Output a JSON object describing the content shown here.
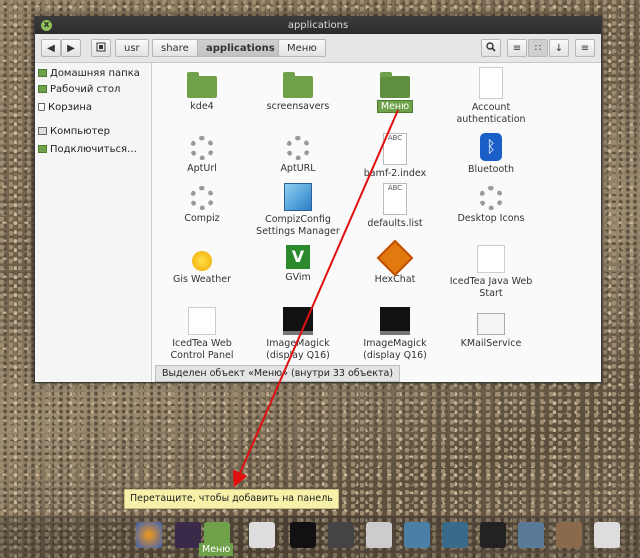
{
  "window": {
    "title": "applications",
    "close_glyph": "x"
  },
  "toolbar": {
    "back_glyph": "◀",
    "forward_glyph": "▶",
    "crumbs": [
      "usr",
      "share",
      "applications",
      "Меню"
    ],
    "search_glyph": "⌕",
    "view_list_glyph": "≡",
    "view_icon_glyph": "∷",
    "sort_glyph": "↓",
    "menu_glyph": "≡"
  },
  "sidebar": {
    "items": [
      {
        "label": "Домашняя папка",
        "icon": "home-folder-icon"
      },
      {
        "label": "Рабочий стол",
        "icon": "desktop-icon"
      },
      {
        "label": "Корзина",
        "icon": "trash-icon"
      },
      {
        "label": "Компьютер",
        "icon": "computer-icon"
      },
      {
        "label": "Подключиться…",
        "icon": "network-icon"
      }
    ]
  },
  "files": [
    {
      "name": "kde4",
      "icon": "folder"
    },
    {
      "name": "screensavers",
      "icon": "folder"
    },
    {
      "name": "Меню",
      "icon": "folder"
    },
    {
      "name": "Account authentication",
      "icon": "document"
    },
    {
      "name": "AptUrl",
      "icon": "gear"
    },
    {
      "name": "AptURL",
      "icon": "gear"
    },
    {
      "name": "bamf-2.index",
      "icon": "text",
      "badge": "ABC"
    },
    {
      "name": "Bluetooth",
      "icon": "bluetooth"
    },
    {
      "name": "Compiz",
      "icon": "gear"
    },
    {
      "name": "CompizConfig Settings Manager",
      "icon": "ccsm"
    },
    {
      "name": "defaults.list",
      "icon": "text",
      "badge": "ABC"
    },
    {
      "name": "Desktop Icons",
      "icon": "gear"
    },
    {
      "name": "Gis Weather",
      "icon": "sun"
    },
    {
      "name": "GVim",
      "icon": "vim"
    },
    {
      "name": "HexChat",
      "icon": "hexchat"
    },
    {
      "name": "IcedTea Java Web Start",
      "icon": "java"
    },
    {
      "name": "IcedTea Web Control Panel",
      "icon": "java"
    },
    {
      "name": "ImageMagick (display Q16)",
      "icon": "monitor"
    },
    {
      "name": "ImageMagick (display Q16)",
      "icon": "monitor"
    },
    {
      "name": "KMailService",
      "icon": "mail"
    }
  ],
  "status": "Выделен объект «Меню» (внутри 33 объекта)",
  "tooltip": "Перетащите, чтобы добавить на панель",
  "drag_label": "Меню",
  "colors": {
    "accent": "#6fa14a",
    "arrow": "#e01010",
    "tooltip_bg": "#f6f0a8"
  }
}
